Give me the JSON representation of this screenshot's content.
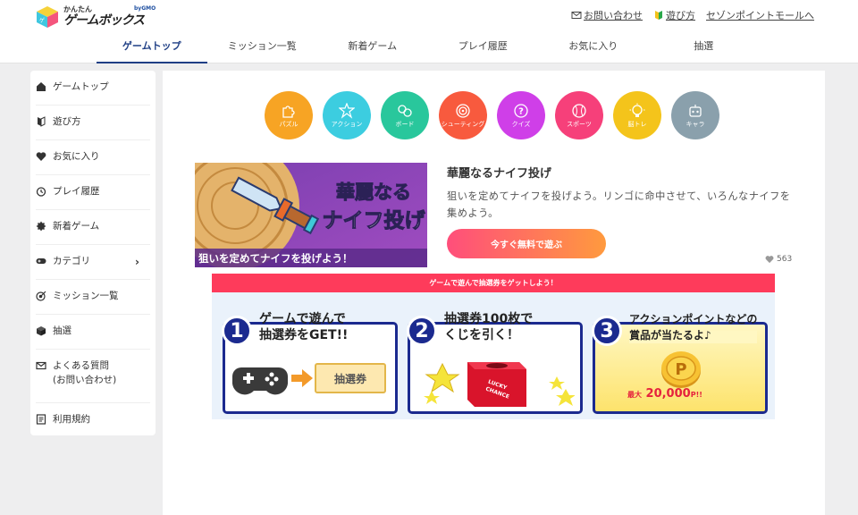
{
  "header": {
    "logo": {
      "small": "かんたん",
      "main": "ゲームボックス",
      "brand": "byGMO"
    },
    "links": [
      {
        "label": "お問い合わせ",
        "icon": "mail-icon"
      },
      {
        "label": "遊び方",
        "icon": "beginner-icon"
      },
      {
        "label": "セゾンポイントモールへ",
        "icon": ""
      }
    ]
  },
  "gnav": [
    {
      "label": "ゲームトップ",
      "active": true
    },
    {
      "label": "ミッション一覧"
    },
    {
      "label": "新着ゲーム"
    },
    {
      "label": "プレイ履歴"
    },
    {
      "label": "お気に入り"
    },
    {
      "label": "抽選"
    }
  ],
  "sidebar": [
    {
      "label": "ゲームトップ",
      "icon": "home-icon"
    },
    {
      "label": "遊び方",
      "icon": "beginner-icon"
    },
    {
      "label": "お気に入り",
      "icon": "heart-icon"
    },
    {
      "label": "プレイ履歴",
      "icon": "history-icon"
    },
    {
      "label": "新着ゲーム",
      "icon": "new-badge-icon"
    },
    {
      "label": "カテゴリ",
      "icon": "gamepad-icon",
      "chevron": "›"
    },
    {
      "label": "ミッション一覧",
      "icon": "target-icon"
    },
    {
      "label": "抽選",
      "icon": "box-icon"
    },
    {
      "label": "よくある質問",
      "label2": "(お問い合わせ)",
      "icon": "mail-icon"
    },
    {
      "label": "利用規約",
      "icon": "document-icon"
    }
  ],
  "categories": [
    {
      "label": "パズル",
      "color": "#f7a424",
      "icon": "puzzle-icon"
    },
    {
      "label": "アクション",
      "color": "#3ccde0",
      "icon": "action-icon"
    },
    {
      "label": "ボード",
      "color": "#29c79c",
      "icon": "board-icon"
    },
    {
      "label": "シューティング",
      "color": "#f85a3e",
      "icon": "target-icon"
    },
    {
      "label": "クイズ",
      "color": "#cf3fe8",
      "icon": "quiz-icon"
    },
    {
      "label": "スポーツ",
      "color": "#f6407a",
      "icon": "baseball-icon"
    },
    {
      "label": "脳トレ",
      "color": "#f4c41b",
      "icon": "bulb-icon"
    },
    {
      "label": "キャラ",
      "color": "#8aa0ac",
      "icon": "robot-icon"
    }
  ],
  "feature": {
    "title": "華麗なるナイフ投げ",
    "description": "狙いを定めてナイフを投げよう。リンゴに命中させて、いろんなナイフを集めよう。",
    "banner_title_line1": "華麗なる",
    "banner_title_line2": "ナイフ投げ",
    "banner_caption": "狙いを定めてナイフを投げよう！",
    "play_button": "今すぐ無料で遊ぶ",
    "likes": "563"
  },
  "lottery": {
    "header": "ゲームで遊んで抽選券をゲットしよう！",
    "steps": [
      {
        "num": "1",
        "title_line1": "ゲームで遊んで",
        "title_line2": "抽選券をGET!!",
        "ticket": "抽選券"
      },
      {
        "num": "2",
        "title_line1": "抽選券100枚で",
        "title_line2": "くじを引く！",
        "box_line1": "LUCKY",
        "box_line2": "CHANCE"
      },
      {
        "num": "3",
        "title_line1": "アクションポイントなどの",
        "title_line2": "賞品が当たるよ♪",
        "coin": "P",
        "prize_prefix": "最大",
        "prize": "20,000",
        "prize_suffix": "P!!"
      }
    ]
  }
}
